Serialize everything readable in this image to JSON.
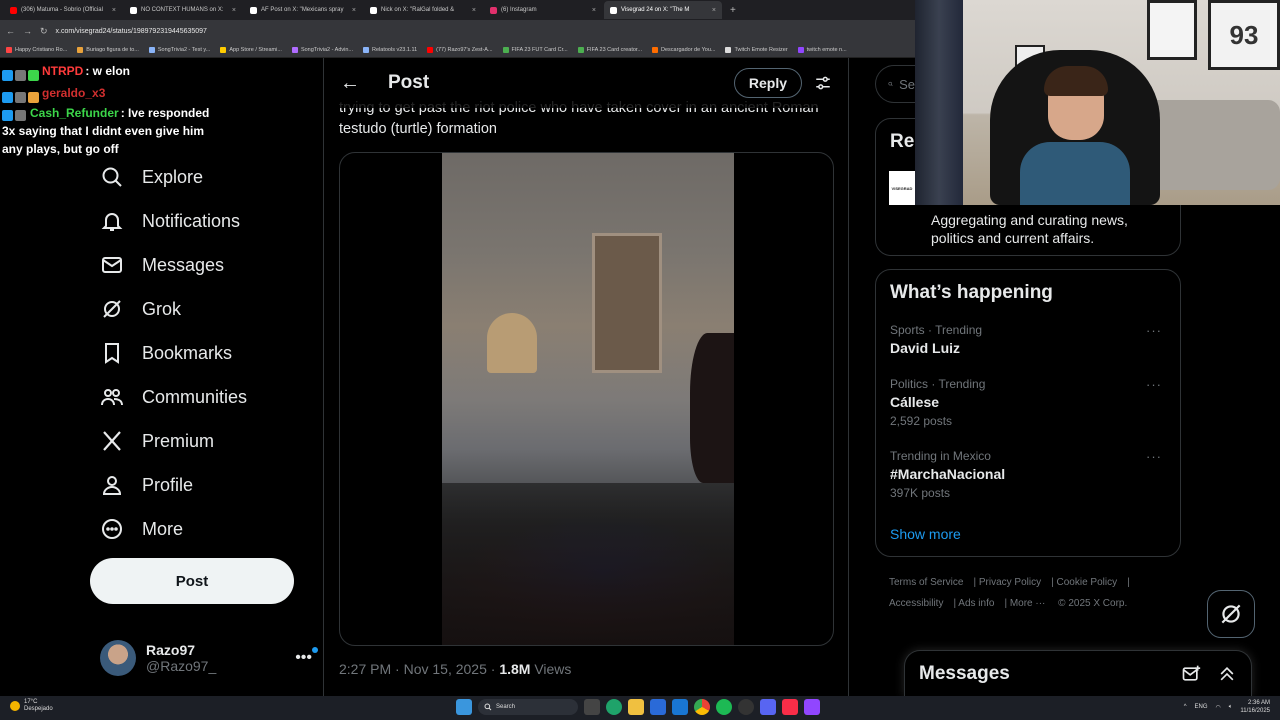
{
  "browser": {
    "tabs": [
      {
        "label": "(306) Matuma - Sobrio (Official",
        "color": "#ff0000"
      },
      {
        "label": "NO CONTEXT HUMANS on X:",
        "color": "#ffffff"
      },
      {
        "label": "AF Post on X: \"Mexicans spray",
        "color": "#ffffff"
      },
      {
        "label": "Nick on X: \"RalGal folded &",
        "color": "#ffffff"
      },
      {
        "label": "(6) Instagram",
        "color": "#e1306c"
      },
      {
        "label": "Visegrad 24 on X: \"The M",
        "color": "#ffffff",
        "active": true
      }
    ],
    "url": "x.com/visegrad24/status/1989792319445635097",
    "bookmarks": [
      {
        "label": "Happy Cristiano Ro...",
        "color": "#ff4444"
      },
      {
        "label": "Buriago figura de to...",
        "color": "#e9a23b"
      },
      {
        "label": "SongTrivia2 - Test y...",
        "color": "#8ab4f8"
      },
      {
        "label": "App Store / Streami...",
        "color": "#ffcc00"
      },
      {
        "label": "SongTrivia2 - Advin...",
        "color": "#b06cff"
      },
      {
        "label": "Relatools v23.1.11",
        "color": "#8ab4f8"
      },
      {
        "label": "(77) Razo97's Zest-A...",
        "color": "#ff0000"
      },
      {
        "label": "FIFA 23 FUT Card Cr...",
        "color": "#4caf50"
      },
      {
        "label": "FIFA 23 Card creator...",
        "color": "#4caf50"
      },
      {
        "label": "Descargador de You...",
        "color": "#ff6d00"
      },
      {
        "label": "Twitch Emote Resizer",
        "color": "#dddddd"
      },
      {
        "label": "twitch emote n...",
        "color": "#9146ff"
      }
    ]
  },
  "chat": [
    {
      "name": "NTRPD",
      "name_color": "#ff3b3b",
      "text": ": w elon"
    },
    {
      "name": "geraldo_x3",
      "name_color": "#d12f2f",
      "text": ""
    },
    {
      "name": "Cash_Refunder",
      "name_color": "#3cd64a",
      "text": ": Ive responded 3x saying that I didnt even give him any plays, but go off"
    }
  ],
  "nav": {
    "items": [
      {
        "label": "Explore",
        "icon": "search-icon"
      },
      {
        "label": "Notifications",
        "icon": "bell-icon"
      },
      {
        "label": "Messages",
        "icon": "mail-icon"
      },
      {
        "label": "Grok",
        "icon": "grok-icon"
      },
      {
        "label": "Bookmarks",
        "icon": "bookmark-icon"
      },
      {
        "label": "Communities",
        "icon": "communities-icon"
      },
      {
        "label": "Premium",
        "icon": "x-logo-icon"
      },
      {
        "label": "Profile",
        "icon": "person-icon"
      },
      {
        "label": "More",
        "icon": "more-circle-icon"
      }
    ],
    "post_label": "Post"
  },
  "account": {
    "name": "Razo97",
    "handle": "@Razo97_"
  },
  "main": {
    "header_title": "Post",
    "reply_label": "Reply",
    "tweet_text": "trying to get past the riot police who have taken cover in an ancient Roman testudo (turtle) formation",
    "time": "2:27 PM · Nov 15, 2025 ·",
    "views_count": "1.8M",
    "views_label": "Views"
  },
  "right": {
    "search_placeholder": "Se",
    "relevant_title": "Rel",
    "relevant_desc": "Aggregating and curating news, politics and current affairs.",
    "relevant_logo": "VISEGRAD",
    "happening_title": "What’s happening",
    "trends": [
      {
        "context": "Sports · Trending",
        "topic": "David Luiz",
        "count": ""
      },
      {
        "context": "Politics · Trending",
        "topic": "Cállese",
        "count": "2,592 posts"
      },
      {
        "context": "Trending in Mexico",
        "topic": "#MarchaNacional",
        "count": "397K posts"
      }
    ],
    "show_more": "Show more",
    "footer": [
      "Terms of Service",
      "Privacy Policy",
      "Cookie Policy",
      "Accessibility",
      "Ads info",
      "More ···",
      "© 2025 X Corp."
    ]
  },
  "messages_drawer": {
    "title": "Messages"
  },
  "webcam": {
    "jersey_number": "93"
  },
  "taskbar": {
    "weather_temp": "17°C",
    "weather_desc": "Despejado",
    "search_label": "Search",
    "lang": "ENG",
    "time": "2:36 AM",
    "date": "11/16/2025"
  },
  "colors": {
    "accent": "#1d9bf0",
    "background": "#000000",
    "text": "#e7e9ea",
    "muted": "#71767b",
    "border": "#2f3336"
  }
}
